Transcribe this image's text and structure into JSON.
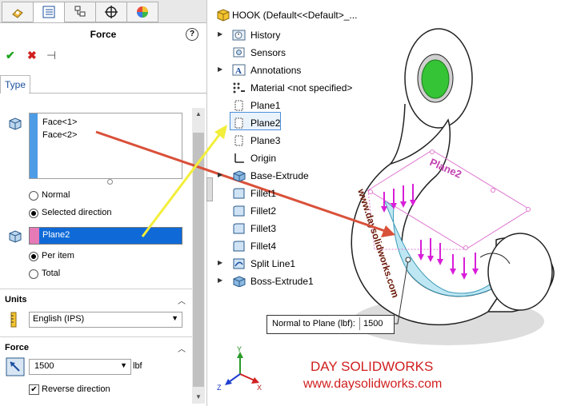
{
  "property_manager": {
    "tabs": [
      "feature-manager",
      "property-manager",
      "configuration-manager",
      "dim-xpert",
      "display-manager"
    ],
    "title": "Force",
    "help": "?",
    "ok": "✔",
    "cancel": "✖",
    "pin": "⊣",
    "type_tab": "Type",
    "faces": [
      "Face<1>",
      "Face<2>"
    ],
    "direction_options": [
      "Normal",
      "Selected direction"
    ],
    "direction_selected": "Selected direction",
    "direction_ref": "Plane2",
    "distribution_options": [
      "Per item",
      "Total"
    ],
    "distribution_selected": "Per item",
    "units": {
      "header": "Units",
      "value": "English (IPS)"
    },
    "force": {
      "header": "Force",
      "value": "1500",
      "unit": "lbf",
      "reverse_label": "Reverse direction",
      "reverse_checked": true
    }
  },
  "tree": {
    "root": "HOOK  (Default<<Default>_...",
    "items": [
      {
        "label": "History",
        "expand": true
      },
      {
        "label": "Sensors",
        "expand": false
      },
      {
        "label": "Annotations",
        "expand": true
      },
      {
        "label": "Material <not specified>",
        "expand": false
      },
      {
        "label": "Plane1",
        "expand": false
      },
      {
        "label": "Plane2",
        "expand": false,
        "selected": true
      },
      {
        "label": "Plane3",
        "expand": false
      },
      {
        "label": "Origin",
        "expand": false
      },
      {
        "label": "Base-Extrude",
        "expand": true
      },
      {
        "label": "Fillet1",
        "expand": false
      },
      {
        "label": "Fillet2",
        "expand": false
      },
      {
        "label": "Fillet3",
        "expand": false
      },
      {
        "label": "Fillet4",
        "expand": false
      },
      {
        "label": "Split Line1",
        "expand": true
      },
      {
        "label": "Boss-Extrude1",
        "expand": true
      }
    ]
  },
  "viewport": {
    "plane_tag": "Plane2",
    "watermark": "www.daysolidworks.com",
    "callout_label": "Normal to Plane (lbf):",
    "callout_value": "1500",
    "brand": "DAY SOLIDWORKS",
    "brand_url": "www.daysolidworks.com",
    "triad": {
      "x": "X",
      "y": "Y",
      "z": "Z"
    }
  },
  "colors": {
    "accent": "#0f6ad8",
    "arrow_red": "#d9513a",
    "arrow_yellow": "#f2ee3a",
    "load_arrow": "#d81fd8",
    "brand": "#d01f1f"
  }
}
